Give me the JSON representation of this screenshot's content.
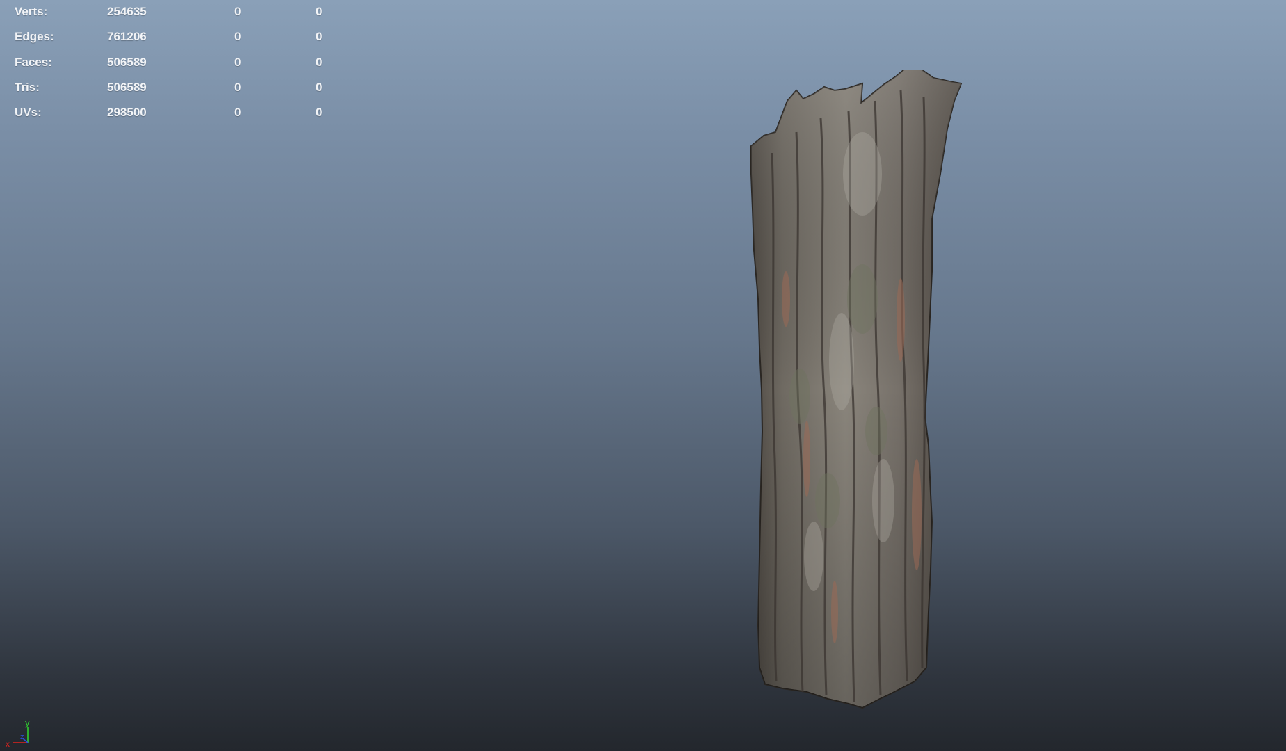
{
  "hud": {
    "rows": [
      {
        "label": "Verts:",
        "total": "254635",
        "selected": "0",
        "component": "0"
      },
      {
        "label": "Edges:",
        "total": "761206",
        "selected": "0",
        "component": "0"
      },
      {
        "label": "Faces:",
        "total": "506589",
        "selected": "0",
        "component": "0"
      },
      {
        "label": "Tris:",
        "total": "506589",
        "selected": "0",
        "component": "0"
      },
      {
        "label": "UVs:",
        "total": "298500",
        "selected": "0",
        "component": "0"
      }
    ]
  },
  "axis": {
    "y_label": "y",
    "z_label": "z",
    "x_label": "x",
    "colors": {
      "x": "#e0231f",
      "y": "#2fd12f",
      "z": "#2c4fd8"
    }
  },
  "model": {
    "icon": "tree-trunk-mesh"
  },
  "colors": {
    "bg_top": "#8aa0b8",
    "bg_bottom": "#23272d",
    "hud_text": "#f2f4f7"
  }
}
